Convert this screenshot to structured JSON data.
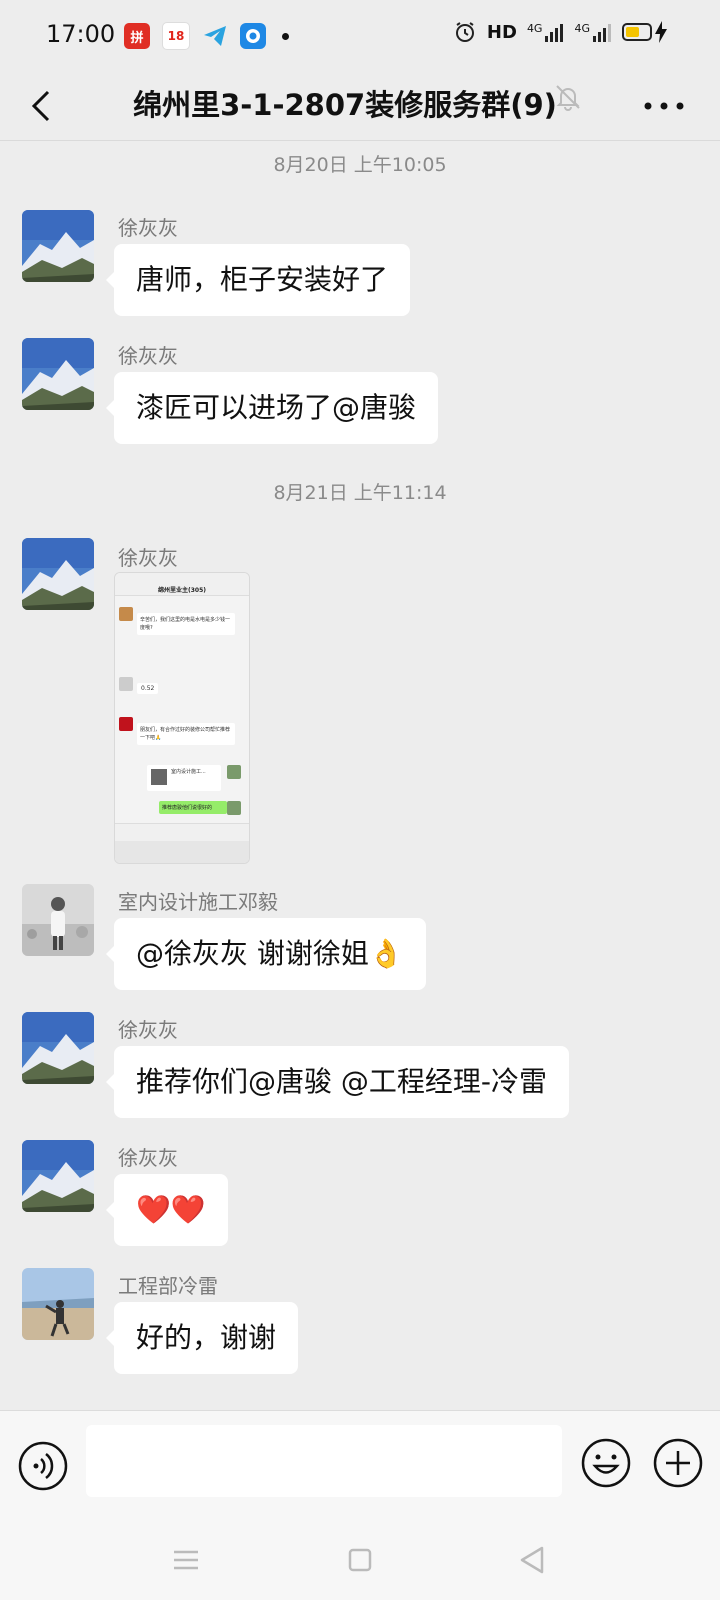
{
  "status": {
    "time": "17:00",
    "network": "HD",
    "signal1": "4G",
    "signal2": "4G",
    "app_icons": [
      {
        "icon": "pdd-app-icon",
        "color": "#e02e24",
        "glyph": "拼"
      },
      {
        "icon": "jd-app-icon",
        "color": "#e1251b",
        "glyph": "18"
      },
      {
        "icon": "telegram-icon",
        "color": "#2aa3e0",
        "glyph": "➤"
      },
      {
        "icon": "browser-app-icon",
        "color": "#1e88e5",
        "glyph": "●"
      }
    ],
    "battery_level": 0.6,
    "battery_color": "#f5c400"
  },
  "header": {
    "title": "绵州里3-1-2807装修服务群(9)"
  },
  "messages": {
    "time1": "8月20日 上午10:05",
    "time2": "8月21日 上午11:14",
    "m1": {
      "sender": "徐灰灰",
      "text": "唐师，柜子安装好了"
    },
    "m2": {
      "sender": "徐灰灰",
      "text": "漆匠可以进场了@唐骏"
    },
    "m3": {
      "sender": "徐灰灰",
      "thumb_title": "绵州里业主(305)",
      "thumb_text1": "辛苦们，我们这里的电是水电是多少钱一度哦?",
      "thumb_value": "0.52",
      "thumb_text2": "朋友们，有合作过好的装修公司帮忙推荐一下吧🙏",
      "thumb_card": "室内设计施工...",
      "thumb_reply": "推荐唐骏他们说很好的"
    },
    "m4": {
      "sender": "室内设计施工邓毅",
      "text": "@徐灰灰  谢谢徐姐👌"
    },
    "m5": {
      "sender": "徐灰灰",
      "text": "推荐你们@唐骏 @工程经理-冷雷"
    },
    "m6": {
      "sender": "徐灰灰",
      "text": "❤️❤️"
    },
    "m7": {
      "sender": "工程部冷雷",
      "text": "好的，谢谢"
    }
  },
  "input": {
    "placeholder": ""
  },
  "colors": {
    "background": "#ededed",
    "bubble": "#ffffff",
    "green_bubble": "#95ec69"
  }
}
